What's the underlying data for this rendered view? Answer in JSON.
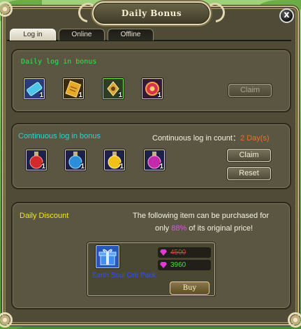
{
  "window": {
    "title": "Daily Bonus",
    "close_label": "x"
  },
  "tabs": [
    {
      "label": "Log in",
      "active": true
    },
    {
      "label": "Online",
      "active": false
    },
    {
      "label": "Offline",
      "active": false
    }
  ],
  "login_bonus": {
    "title": "Daily log in bonus",
    "items": [
      {
        "icon": "blue-ticket-icon",
        "qty": "1"
      },
      {
        "icon": "gold-scroll-icon",
        "qty": "1"
      },
      {
        "icon": "golden-crest-icon",
        "qty": "1"
      },
      {
        "icon": "red-gem-icon",
        "qty": "1"
      }
    ],
    "claim_label": "Claim",
    "claim_enabled": false
  },
  "continuous_bonus": {
    "title": "Continuous log in bonus",
    "count_label": "Continuous log in count：",
    "count_value": "2 Day(s)",
    "items": [
      {
        "icon": "red-potion-icon",
        "qty": "1"
      },
      {
        "icon": "blue-potion-icon",
        "qty": "1"
      },
      {
        "icon": "yellow-potion-icon",
        "qty": "1"
      },
      {
        "icon": "purple-potion-icon",
        "qty": "1"
      }
    ],
    "claim_label": "Claim",
    "reset_label": "Reset"
  },
  "daily_discount": {
    "title": "Daily Discount",
    "desc_line1": "The following item can be purchased for",
    "desc_prefix": "only ",
    "percent": "88%",
    "desc_suffix": " of its original price!",
    "item_name": "Earth Soul Orb Pack",
    "item_icon": "gift-box-icon",
    "old_price": "4500",
    "new_price": "3960",
    "currency_icon": "diamond-icon",
    "buy_label": "Buy"
  },
  "colors": {
    "login_title": "#31e64a",
    "continuous_title": "#27d8d0",
    "discount_title": "#f3e62b",
    "old_price": "#e0412f",
    "new_price": "#3fe23a",
    "item_name": "#2a56e6",
    "percent": "#d45fd8",
    "count_value": "#ef6d2c"
  }
}
